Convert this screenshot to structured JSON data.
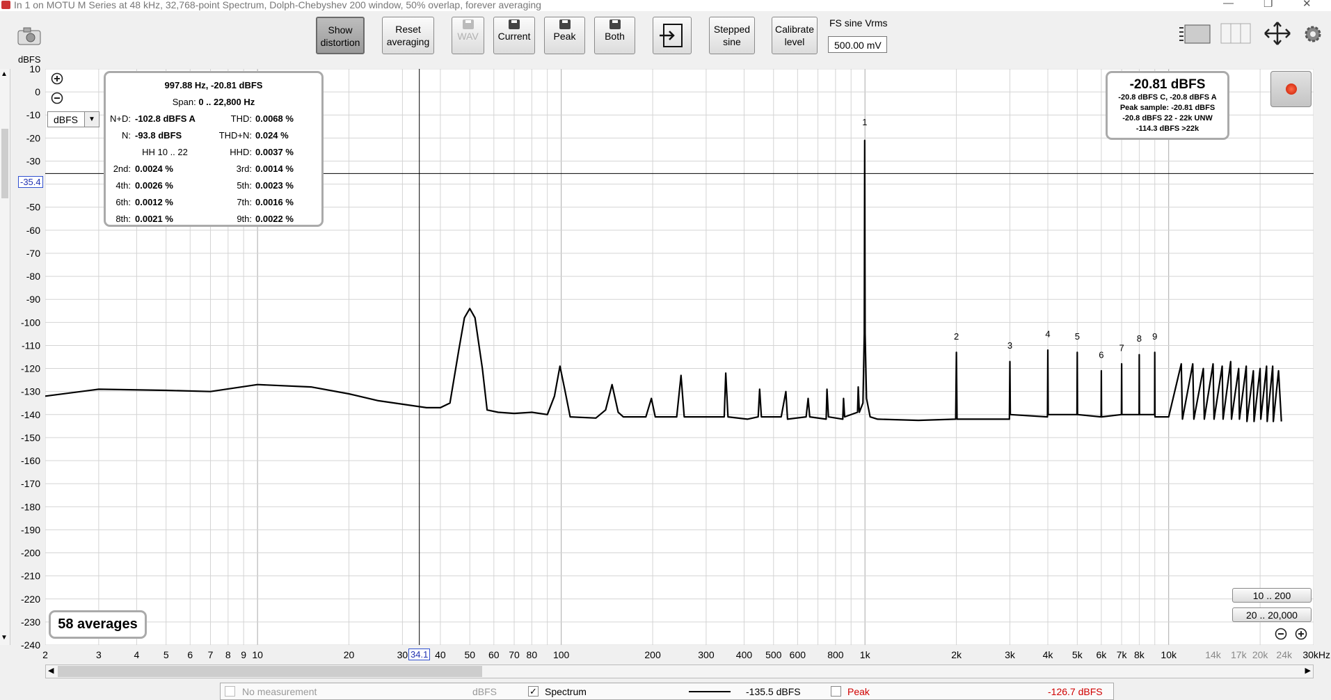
{
  "window": {
    "title": "In 1 on MOTU M Series at 48 kHz, 32,768-point Spectrum, Dolph-Chebyshev 200 window, 50% overlap, forever averaging"
  },
  "toolbar": {
    "show_distortion": "Show distortion",
    "reset_averaging": "Reset averaging",
    "wav": "WAV",
    "current": "Current",
    "peak": "Peak",
    "both": "Both",
    "stepped_sine": "Stepped sine",
    "calibrate_level": "Calibrate level",
    "fs_sine_label": "FS sine Vrms",
    "fs_sine_value": "500.00 mV"
  },
  "units": {
    "ylabel": "dBFS",
    "selector": "dBFS"
  },
  "info_panel": {
    "header1": "997.88 Hz, -20.81 dBFS",
    "span_label": "Span:",
    "span_value": "0 .. 22,800 Hz",
    "rows": [
      {
        "k1": "N+D:",
        "v1": "-102.8 dBFS A",
        "k2": "THD:",
        "v2": "0.0068 %"
      },
      {
        "k1": "N:",
        "v1": "-93.8 dBFS",
        "k2": "THD+N:",
        "v2": "0.024 %"
      },
      {
        "k1": "",
        "v1": "HH 10 .. 22",
        "k2": "HHD:",
        "v2": "0.0037 %"
      },
      {
        "k1": "2nd:",
        "v1": "0.0024 %",
        "k2": "3rd:",
        "v2": "0.0014 %"
      },
      {
        "k1": "4th:",
        "v1": "0.0026 %",
        "k2": "5th:",
        "v2": "0.0023 %"
      },
      {
        "k1": "6th:",
        "v1": "0.0012 %",
        "k2": "7th:",
        "v2": "0.0016 %"
      },
      {
        "k1": "8th:",
        "v1": "0.0021 %",
        "k2": "9th:",
        "v2": "0.0022 %"
      }
    ]
  },
  "level_panel": {
    "main": "-20.81 dBFS",
    "lines": [
      "-20.8 dBFS C, -20.8 dBFS A",
      "Peak sample: -20.81 dBFS",
      "-20.8 dBFS 22 - 22k UNW",
      "-114.3 dBFS >22k"
    ]
  },
  "averages": "58 averages",
  "range_buttons": [
    "10 .. 200",
    "20 .. 20,000"
  ],
  "cursor": {
    "y_readout": "-35.4",
    "x_readout": "34.1"
  },
  "status": {
    "no_measurement": "No measurement",
    "no_measurement_unit": "dBFS",
    "spectrum_label": "Spectrum",
    "spectrum_value": "-135.5 dBFS",
    "peak_label": "Peak",
    "peak_value": "-126.7 dBFS",
    "spectrum_checked": "✓"
  },
  "colors": {
    "trace": "#000000",
    "grid": "#c8c8c8",
    "peak": "#d00000",
    "cursor": "#000000"
  },
  "chart_data": {
    "type": "line",
    "title": "",
    "xlabel": "",
    "ylabel": "dBFS",
    "x_scale": "log",
    "xlim": [
      2,
      30000
    ],
    "ylim": [
      -240,
      10
    ],
    "y_ticks": [
      10,
      0,
      -10,
      -20,
      -30,
      -40,
      -50,
      -60,
      -70,
      -80,
      -90,
      -100,
      -110,
      -120,
      -130,
      -140,
      -150,
      -160,
      -170,
      -180,
      -190,
      -200,
      -210,
      -220,
      -230,
      -240
    ],
    "x_tick_labels": [
      {
        "v": 2,
        "t": "2"
      },
      {
        "v": 3,
        "t": "3"
      },
      {
        "v": 4,
        "t": "4"
      },
      {
        "v": 5,
        "t": "5"
      },
      {
        "v": 6,
        "t": "6"
      },
      {
        "v": 7,
        "t": "7"
      },
      {
        "v": 8,
        "t": "8"
      },
      {
        "v": 9,
        "t": "9"
      },
      {
        "v": 10,
        "t": "10"
      },
      {
        "v": 20,
        "t": "20"
      },
      {
        "v": 30,
        "t": "30"
      },
      {
        "v": 40,
        "t": "40"
      },
      {
        "v": 50,
        "t": "50"
      },
      {
        "v": 60,
        "t": "60"
      },
      {
        "v": 70,
        "t": "70"
      },
      {
        "v": 80,
        "t": "80"
      },
      {
        "v": 100,
        "t": "100"
      },
      {
        "v": 200,
        "t": "200"
      },
      {
        "v": 300,
        "t": "300"
      },
      {
        "v": 400,
        "t": "400"
      },
      {
        "v": 500,
        "t": "500"
      },
      {
        "v": 600,
        "t": "600"
      },
      {
        "v": 800,
        "t": "800"
      },
      {
        "v": 1000,
        "t": "1k"
      },
      {
        "v": 2000,
        "t": "2k"
      },
      {
        "v": 3000,
        "t": "3k"
      },
      {
        "v": 4000,
        "t": "4k"
      },
      {
        "v": 5000,
        "t": "5k"
      },
      {
        "v": 6000,
        "t": "6k"
      },
      {
        "v": 7000,
        "t": "7k"
      },
      {
        "v": 8000,
        "t": "8k"
      },
      {
        "v": 10000,
        "t": "10k"
      },
      {
        "v": 14000,
        "t": "14k"
      },
      {
        "v": 17000,
        "t": "17k"
      },
      {
        "v": 20000,
        "t": "20k"
      },
      {
        "v": 24000,
        "t": "24k"
      },
      {
        "v": 30000,
        "t": "30kHz"
      }
    ],
    "grid": true,
    "cursor": {
      "x": 34.1,
      "y": -35.4
    },
    "series": [
      {
        "values": [
          [
            2,
            -132
          ],
          [
            3,
            -129
          ],
          [
            5,
            -129.5
          ],
          [
            7,
            -130
          ],
          [
            10,
            -127
          ],
          [
            15,
            -128
          ],
          [
            20,
            -131
          ],
          [
            25,
            -134
          ],
          [
            30,
            -135.5
          ],
          [
            36,
            -137
          ],
          [
            40,
            -137
          ],
          [
            43,
            -135
          ],
          [
            46,
            -112
          ],
          [
            48,
            -98
          ],
          [
            50,
            -94
          ],
          [
            52,
            -98
          ],
          [
            55,
            -120
          ],
          [
            57,
            -138
          ],
          [
            62,
            -139
          ],
          [
            70,
            -139.5
          ],
          [
            80,
            -139
          ],
          [
            90,
            -140
          ],
          [
            95,
            -132
          ],
          [
            99,
            -119
          ],
          [
            103,
            -130
          ],
          [
            107,
            -141
          ],
          [
            130,
            -141.5
          ],
          [
            140,
            -138
          ],
          [
            147,
            -127
          ],
          [
            154,
            -139
          ],
          [
            160,
            -141
          ],
          [
            190,
            -141
          ],
          [
            198,
            -133
          ],
          [
            204,
            -141
          ],
          [
            240,
            -141
          ],
          [
            248,
            -123
          ],
          [
            254,
            -141
          ],
          [
            300,
            -141
          ],
          [
            344,
            -141
          ],
          [
            348,
            -122
          ],
          [
            354,
            -141
          ],
          [
            410,
            -142
          ],
          [
            445,
            -141
          ],
          [
            450,
            -129
          ],
          [
            456,
            -141
          ],
          [
            530,
            -141
          ],
          [
            549,
            -130
          ],
          [
            556,
            -142
          ],
          [
            640,
            -141
          ],
          [
            650,
            -133
          ],
          [
            658,
            -141
          ],
          [
            745,
            -142
          ],
          [
            750,
            -129
          ],
          [
            758,
            -141
          ],
          [
            845,
            -142
          ],
          [
            850,
            -133
          ],
          [
            857,
            -141
          ],
          [
            945,
            -139
          ],
          [
            950,
            -128
          ],
          [
            958,
            -139
          ],
          [
            985,
            -135
          ],
          [
            995,
            -105
          ],
          [
            998,
            -21
          ],
          [
            1001,
            -105
          ],
          [
            1012,
            -133
          ],
          [
            1040,
            -141
          ],
          [
            1100,
            -142
          ],
          [
            1500,
            -142.5
          ],
          [
            1990,
            -142
          ],
          [
            2000,
            -113
          ],
          [
            2010,
            -142
          ],
          [
            2600,
            -142
          ],
          [
            2990,
            -142
          ],
          [
            3000,
            -117
          ],
          [
            3010,
            -140
          ],
          [
            3990,
            -141
          ],
          [
            4000,
            -112
          ],
          [
            4010,
            -140
          ],
          [
            4990,
            -140
          ],
          [
            5000,
            -113
          ],
          [
            5010,
            -140
          ],
          [
            5990,
            -141
          ],
          [
            6000,
            -121
          ],
          [
            6010,
            -141
          ],
          [
            6990,
            -140
          ],
          [
            7000,
            -118
          ],
          [
            7010,
            -140
          ],
          [
            7990,
            -140
          ],
          [
            8000,
            -114
          ],
          [
            8010,
            -140
          ],
          [
            8990,
            -140
          ],
          [
            9000,
            -113
          ],
          [
            9010,
            -141
          ],
          [
            10000,
            -141
          ],
          [
            11000,
            -118
          ],
          [
            11100,
            -142
          ],
          [
            12000,
            -118
          ],
          [
            12100,
            -142
          ],
          [
            13000,
            -120
          ],
          [
            13100,
            -142
          ],
          [
            14000,
            -118
          ],
          [
            14100,
            -142
          ],
          [
            15000,
            -119
          ],
          [
            15100,
            -142
          ],
          [
            16000,
            -117
          ],
          [
            16100,
            -142
          ],
          [
            17000,
            -120
          ],
          [
            17100,
            -142
          ],
          [
            18000,
            -119
          ],
          [
            18100,
            -143
          ],
          [
            19000,
            -121
          ],
          [
            19100,
            -143
          ],
          [
            20000,
            -120
          ],
          [
            20100,
            -142
          ],
          [
            21000,
            -119
          ],
          [
            21100,
            -143
          ],
          [
            22000,
            -119
          ],
          [
            22100,
            -143
          ],
          [
            23000,
            -121
          ],
          [
            23500,
            -143
          ]
        ]
      }
    ],
    "harmonic_labels": [
      {
        "n": "1",
        "x": 998,
        "y": -15
      },
      {
        "n": "2",
        "x": 2000,
        "y": -108
      },
      {
        "n": "3",
        "x": 3000,
        "y": -112
      },
      {
        "n": "4",
        "x": 4000,
        "y": -107
      },
      {
        "n": "5",
        "x": 5000,
        "y": -108
      },
      {
        "n": "6",
        "x": 6000,
        "y": -116
      },
      {
        "n": "7",
        "x": 7000,
        "y": -113
      },
      {
        "n": "8",
        "x": 8000,
        "y": -109
      },
      {
        "n": "9",
        "x": 9000,
        "y": -108
      }
    ]
  }
}
